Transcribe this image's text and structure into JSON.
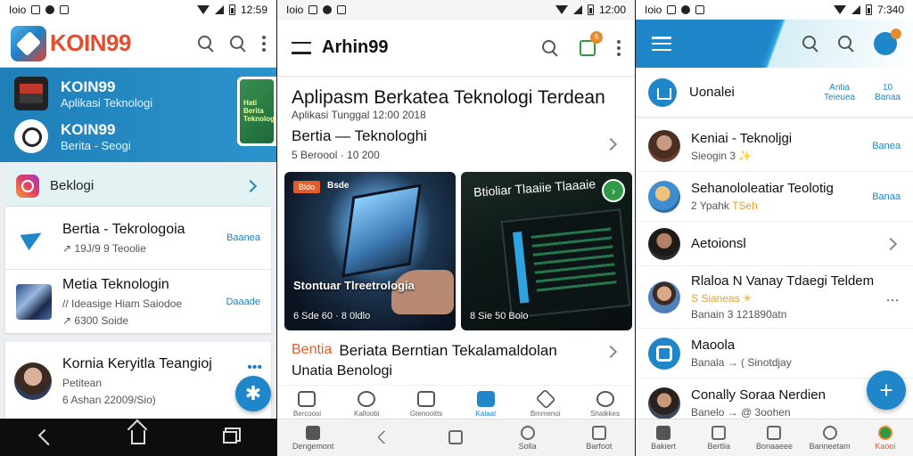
{
  "panel1": {
    "status": {
      "left": "Ioio",
      "time": "12:59"
    },
    "brand": "KOIN99",
    "accounts": [
      {
        "name": "KOIN99",
        "sub": "Aplikasi Teknologi"
      },
      {
        "name": "KOIN99",
        "sub": "Berita - Seogi"
      }
    ],
    "side_thumb": "Hati\nBerita\nTeknologi",
    "category": {
      "label": "Beklogi"
    },
    "items": [
      {
        "title": "Bertia - Tekrologoia",
        "meta": "↗ 19J/9 9 Teoolie",
        "badge": "Baanea"
      },
      {
        "title": "Metia Teknologin",
        "meta": "// Ideasige Hiam Saiodoe",
        "meta2": "↗ 6300 Soide",
        "badge": "Daaade"
      }
    ],
    "card2": {
      "title": "Kornia Keryitla Teangioj",
      "meta": "Petitean",
      "meta2": "6 Ashan 22009/Sio)"
    },
    "fab_icon": "✱"
  },
  "panel2": {
    "status": {
      "left": "Ioio",
      "time": "12:00"
    },
    "brand": "Arhin99",
    "notif_count": "6",
    "headline": "Aplipasm Berkatea Teknologi Terdean",
    "headline_sub": "Aplikasi Tunggal 12:00 2018",
    "row": {
      "title": "Bertia — Teknologhi",
      "meta": "5 Beroool · 10 200"
    },
    "media": [
      {
        "tag": "Bldo",
        "tag2": "Bsde",
        "title": "Stontuar Tlreetrologia",
        "meta": "6 Sde 60 · 8 0ldlo"
      },
      {
        "heading": "Btioliar Tlaaiie Tlaaaie",
        "meta": "8 Sie 50 Bolo"
      }
    ],
    "article": {
      "tag": "Bentia",
      "title": "Beriata Berntian Tekalamaldolan",
      "sub": "Unatia Benologi"
    },
    "tabs": [
      {
        "label": "Bercoosi"
      },
      {
        "label": "Kalloobi"
      },
      {
        "label": "Gtenooitts"
      },
      {
        "label": "Kalaat"
      },
      {
        "label": "Bmmenoi"
      },
      {
        "label": "Shatkkes"
      }
    ],
    "bottom": [
      {
        "label": "Dengemont"
      },
      {
        "label": ""
      },
      {
        "label": ""
      },
      {
        "label": "Solla"
      },
      {
        "label": "Barfoot"
      }
    ]
  },
  "panel3": {
    "status": {
      "left": "Ioio",
      "time": "7:340"
    },
    "card": {
      "title": "Uonalei",
      "stat1": "Antia\nTeieuea",
      "stat2": "10\nBanaa"
    },
    "items": [
      {
        "title": "Keniai - Teknoljgi",
        "meta": "Sieogin 3",
        "meta_emoji": "✨",
        "action": "Banea"
      },
      {
        "title": "Sehanololeatiar Teolotig",
        "meta": "2 Ypahk",
        "meta_emoji": "TSeh",
        "action": "Banaa"
      },
      {
        "title": "Aetoionsl",
        "meta": ""
      },
      {
        "title": "Rlaloa N Vanay Tdaegi Teldem",
        "meta": "S Sianeas",
        "meta_emoji": "✳",
        "meta2": "Banain 3 121890atn"
      },
      {
        "title": "Maoola",
        "meta": "Banala → ( Sinotdjay"
      },
      {
        "title": "Conally Soraa Nerdien",
        "meta": "Banelo → @ 3oohen"
      }
    ],
    "bottom": [
      {
        "label": "Bakiert"
      },
      {
        "label": "Bertlia"
      },
      {
        "label": "Bonaaeee"
      },
      {
        "label": "Banneetam"
      },
      {
        "label": "Kaooi"
      }
    ],
    "fab_icon": "+"
  }
}
